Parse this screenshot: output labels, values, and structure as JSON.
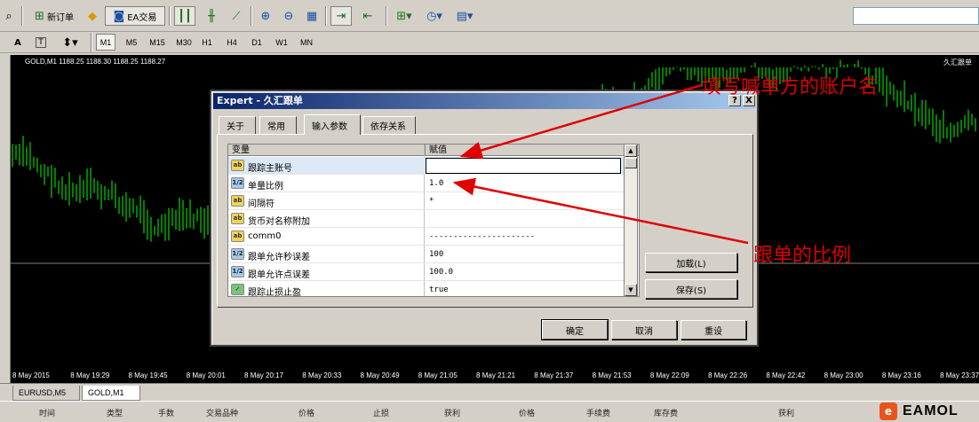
{
  "toolbar": {
    "new_order_label": "新订单",
    "ea_trade_label": "EA交易"
  },
  "timeframes": [
    "M1",
    "M5",
    "M15",
    "M30",
    "H1",
    "H4",
    "D1",
    "W1",
    "MN"
  ],
  "timeframe_active": "M1",
  "chart": {
    "title": "GOLD,M1  1188.25 1188.30 1188.25 1188.27",
    "tag": "久汇跟单",
    "time_labels": [
      "8 May 2015",
      "8 May 19:29",
      "8 May 19:45",
      "8 May 20:01",
      "8 May 20:17",
      "8 May 20:33",
      "8 May 20:49",
      "8 May 21:05",
      "8 May 21:21",
      "8 May 21:37",
      "8 May 21:53",
      "8 May 22:09",
      "8 May 22:26",
      "8 May 22:42",
      "8 May 23:00",
      "8 May 23:16",
      "8 May 23:37"
    ],
    "bar_color": "#00ff00"
  },
  "chart_tabs": [
    "EURUSD,M5",
    "GOLD,M1"
  ],
  "chart_tab_active": "GOLD,M1",
  "terminal_headers": [
    "时间",
    "类型",
    "手数",
    "交易品种",
    "价格",
    "止损",
    "获利",
    "价格",
    "手续费",
    "库存费",
    "获利"
  ],
  "dialog": {
    "title": "Expert - 久汇跟单",
    "help_btn": "?",
    "close_btn": "X",
    "tabs": [
      "关于",
      "常用",
      "输入参数",
      "依存关系"
    ],
    "active_tab": "输入参数",
    "col_variable": "变量",
    "col_value": "赋值",
    "params": [
      {
        "icon": "ab",
        "name": "跟踪主账号",
        "value": ""
      },
      {
        "icon": "num",
        "name": "单量比例",
        "value": "1.0"
      },
      {
        "icon": "ab",
        "name": "间隔符",
        "value": "*"
      },
      {
        "icon": "ab",
        "name": "货币对名称附加",
        "value": ""
      },
      {
        "icon": "ab",
        "name": "comm0",
        "value": "----------------------"
      },
      {
        "icon": "num",
        "name": "跟单允许秒误差",
        "value": "100"
      },
      {
        "icon": "num",
        "name": "跟单允许点误差",
        "value": "100.0"
      },
      {
        "icon": "bool",
        "name": "跟踪止损止盈",
        "value": "true"
      }
    ],
    "load_btn": "加载(L)",
    "save_btn": "保存(S)",
    "ok_btn": "确定",
    "cancel_btn": "取消",
    "reset_btn": "重设"
  },
  "annotations": {
    "account_note": "填写喊单方的账户名",
    "ratio_note": "跟单的比例",
    "arrow_color": "#e00000"
  },
  "watermark": {
    "text": "EAMOL",
    "icon_glyph": "e"
  }
}
